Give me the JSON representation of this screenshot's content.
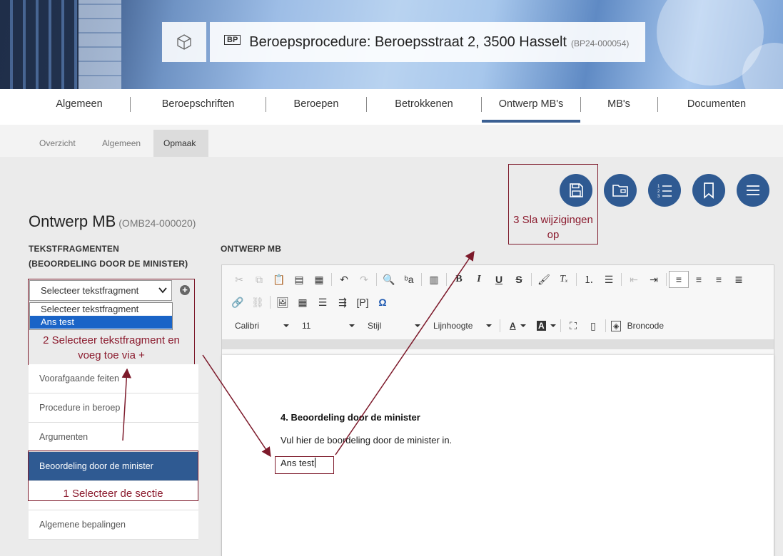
{
  "header": {
    "badge": "BP",
    "title": "Beroepsprocedure: Beroepsstraat 2, 3500 Hasselt",
    "subtitle": "(BP24-000054)"
  },
  "main_tabs": [
    {
      "label": "Algemeen"
    },
    {
      "label": "Beroepschriften"
    },
    {
      "label": "Beroepen"
    },
    {
      "label": "Betrokkenen"
    },
    {
      "label": "Ontwerp MB's"
    },
    {
      "label": "MB's"
    },
    {
      "label": "Documenten"
    }
  ],
  "sub_tabs": [
    {
      "label": "Overzicht"
    },
    {
      "label": "Algemeen"
    },
    {
      "label": "Opmaak"
    }
  ],
  "page": {
    "title": "Ontwerp MB",
    "code": "(OMB24-000020)",
    "left_label": "TEKSTFRAGMENTEN (BEOORDELING DOOR DE MINISTER)",
    "right_label": "ONTWERP MB"
  },
  "fragment_select": {
    "value": "Selecteer tekstfragment",
    "options": [
      "Selecteer tekstfragment",
      "Ans test"
    ]
  },
  "sections": [
    {
      "label": "Voorafgaande feiten"
    },
    {
      "label": "Procedure in beroep"
    },
    {
      "label": "Argumenten"
    },
    {
      "label": "Beoordeling door de minister"
    },
    {
      "label": "Algemene bepalingen"
    }
  ],
  "toolbar": {
    "font": "Calibri",
    "size": "11",
    "style": "Stijl",
    "line_height": "Lijnhoogte",
    "source": "Broncode"
  },
  "document": {
    "heading": "4. Beoordeling door de minister",
    "paragraph": "Vul hier de boordeling door de minister in.",
    "inserted": "Ans test"
  },
  "annotations": {
    "step1": "1 Selecteer de sectie",
    "step2": "2 Selecteer tekstfragment en voeg toe via +",
    "step3": "3 Sla wijzigingen op"
  },
  "colors": {
    "accent": "#2f5a92",
    "annotation": "#8b1b2e"
  }
}
